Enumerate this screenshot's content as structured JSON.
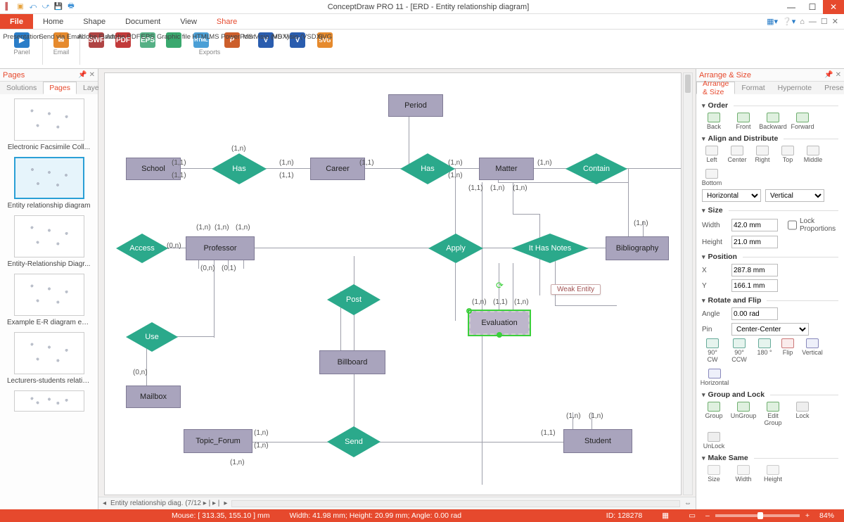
{
  "title": "ConceptDraw PRO 11 - [ERD - Entity relationship diagram]",
  "menutabs": {
    "file": "File",
    "home": "Home",
    "shape": "Shape",
    "document": "Document",
    "view": "View",
    "share": "Share"
  },
  "ribbon": {
    "presentation": "Presentation",
    "panel": "Panel",
    "sendviaemail": "Send via Email",
    "email": "Email",
    "flash": "Adobe Flash",
    "pdf": "Adobe PDF",
    "eps": "EPS",
    "gfx": "Graphic file",
    "html": "HTML",
    "ppt": "MS PowerPoint",
    "vdx": "MS Visio (VDX)",
    "vsdx": "MS Visio (VSDX)",
    "svg": "SVG",
    "exports": "Exports",
    "i": {
      "swf": "SWF",
      "pdf": "PDF",
      "eps": "EPS",
      "gfx": "",
      "html": "HTML",
      "ppt": "P",
      "vdx": "V",
      "vsdx": "V",
      "svg": "SVG",
      "play": "▶",
      "mail": "✉"
    }
  },
  "pages": {
    "title": "Pages",
    "tabs": {
      "solutions": "Solutions",
      "pages": "Pages",
      "layers": "Layers"
    },
    "thumbs": [
      {
        "cap": "Electronic Facsimile Coll..."
      },
      {
        "cap": "Entity relationship diagram",
        "sel": true
      },
      {
        "cap": "Entity-Relationship Diagr..."
      },
      {
        "cap": "Example E-R diagram ext..."
      },
      {
        "cap": "Lecturers-students relatio..."
      }
    ]
  },
  "erd": {
    "entities": {
      "school": "School",
      "career": "Career",
      "period": "Period",
      "matter": "Matter",
      "professor": "Professor",
      "bibliography": "Bibliography",
      "evaluation": "Evaluation",
      "billboard": "Billboard",
      "mailbox": "Mailbox",
      "topic_forum": "Topic_Forum",
      "student": "Student"
    },
    "relationships": {
      "has1": "Has",
      "has2": "Has",
      "contain": "Contain",
      "access": "Access",
      "apply": "Apply",
      "ithasnotes": "It Has Notes",
      "use": "Use",
      "post": "Post",
      "send": "Send"
    },
    "cards": {
      "c11": "(1,1)",
      "c1n": "(1,n)",
      "c0n": "(0,n)",
      "c01": "(0,1)"
    },
    "tooltip": "Weak Entity"
  },
  "hbar": {
    "pager": "Entity relationship diag.  (7/12 ▸ | ▸ |"
  },
  "rightpanel": {
    "title": "Arrange & Size",
    "tabs": {
      "arrange": "Arrange & Size",
      "format": "Format",
      "hypernote": "Hypernote",
      "presentation": "Presentation"
    },
    "sections": {
      "order": {
        "h": "Order",
        "back": "Back",
        "front": "Front",
        "backward": "Backward",
        "forward": "Forward"
      },
      "align": {
        "h": "Align and Distribute",
        "left": "Left",
        "center": "Center",
        "right": "Right",
        "top": "Top",
        "middle": "Middle",
        "bottom": "Bottom",
        "horizontal": "Horizontal",
        "vertical": "Vertical"
      },
      "size": {
        "h": "Size",
        "width_l": "Width",
        "width_v": "42.0 mm",
        "height_l": "Height",
        "height_v": "21.0 mm",
        "lock": "Lock Proportions"
      },
      "position": {
        "h": "Position",
        "x_l": "X",
        "x_v": "287.8 mm",
        "y_l": "Y",
        "y_v": "166.1 mm"
      },
      "rotate": {
        "h": "Rotate and Flip",
        "angle_l": "Angle",
        "angle_v": "0.00 rad",
        "pin_l": "Pin",
        "pin_v": "Center-Center",
        "cw": "90° CW",
        "ccw": "90° CCW",
        "d180": "180 °",
        "flip": "Flip",
        "vert": "Vertical",
        "horiz": "Horizontal"
      },
      "group": {
        "h": "Group and Lock",
        "group": "Group",
        "ungroup": "UnGroup",
        "edit": "Edit Group",
        "lock": "Lock",
        "unlock": "UnLock"
      },
      "same": {
        "h": "Make Same",
        "size": "Size",
        "width": "Width",
        "height": "Height"
      }
    }
  },
  "status": {
    "mouse": "Mouse: [ 313.35, 155.10 ] mm",
    "dims": "Width: 41.98 mm;  Height: 20.99 mm;  Angle: 0.00 rad",
    "id": "ID: 128278",
    "zoom": "84%"
  }
}
